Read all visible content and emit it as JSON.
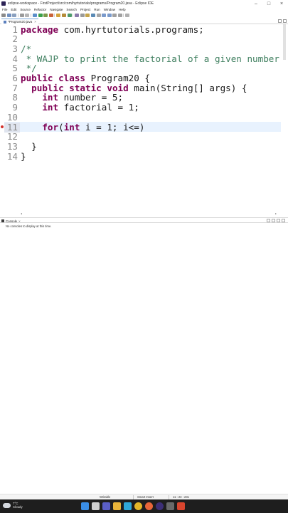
{
  "window": {
    "title": "eclipse-workspace - FirstProject/src/com/hyrtutorials/programs/Program20.java - Eclipse IDE",
    "controls": [
      "minimize-icon",
      "maximize-icon",
      "close-icon"
    ]
  },
  "menubar": {
    "items": [
      "File",
      "Edit",
      "Source",
      "Refactor",
      "Navigate",
      "Search",
      "Project",
      "Run",
      "Window",
      "Help"
    ]
  },
  "editor_tab": {
    "label": "*Program20.java",
    "close": "×"
  },
  "editor": {
    "line_numbers": [
      "1",
      "2",
      "3",
      "4",
      "5",
      "6",
      "7",
      "8",
      "9",
      "10",
      "11",
      "12",
      "13",
      "14"
    ],
    "lines": [
      [
        {
          "t": "package",
          "k": "kw"
        },
        {
          "t": " com.hyrtutorials.programs;",
          "k": ""
        }
      ],
      [],
      [
        {
          "t": "/*",
          "k": "cmt"
        }
      ],
      [
        {
          "t": " * WAJP to print the factorial of a given number",
          "k": "cmt"
        }
      ],
      [
        {
          "t": " */",
          "k": "cmt"
        }
      ],
      [
        {
          "t": "public",
          "k": "kw"
        },
        {
          "t": " ",
          "k": ""
        },
        {
          "t": "class",
          "k": "kw"
        },
        {
          "t": " Program20 {",
          "k": ""
        }
      ],
      [
        {
          "t": "  ",
          "k": ""
        },
        {
          "t": "public",
          "k": "kw"
        },
        {
          "t": " ",
          "k": ""
        },
        {
          "t": "static",
          "k": "kw"
        },
        {
          "t": " ",
          "k": ""
        },
        {
          "t": "void",
          "k": "kw"
        },
        {
          "t": " main(String[] args) {",
          "k": ""
        }
      ],
      [
        {
          "t": "    ",
          "k": ""
        },
        {
          "t": "int",
          "k": "kw"
        },
        {
          "t": " number = 5;",
          "k": ""
        }
      ],
      [
        {
          "t": "    ",
          "k": ""
        },
        {
          "t": "int",
          "k": "kw"
        },
        {
          "t": " factorial = 1;",
          "k": ""
        }
      ],
      [],
      [
        {
          "t": "    ",
          "k": ""
        },
        {
          "t": "for",
          "k": "kw"
        },
        {
          "t": "(",
          "k": ""
        },
        {
          "t": "int",
          "k": "kw"
        },
        {
          "t": " i = 1; i<=)",
          "k": ""
        }
      ],
      [],
      [
        {
          "t": "  }",
          "k": ""
        }
      ],
      [
        {
          "t": "}",
          "k": ""
        }
      ]
    ],
    "current_line": "11",
    "error_line": "11"
  },
  "console": {
    "tab_label": "Console",
    "close": "×",
    "message": "No consoles to display at this time."
  },
  "statusbar": {
    "mode": "Writable",
    "insert": "Smart Insert",
    "position": "11 : 23 : 231"
  },
  "taskbar": {
    "temperature": "7°C",
    "condition": "Cloudy",
    "apps": [
      "windows-start-icon",
      "file-explorer-icon",
      "teams-icon",
      "folder-icon",
      "edge-icon",
      "chrome-icon",
      "firefox-icon",
      "eclipse-icon",
      "media-icon",
      "app-icon"
    ]
  },
  "colors": {
    "keyword": "#7f0055",
    "comment": "#3f7f5f",
    "current_line_bg": "#e8f2fe",
    "taskbar_bg": "#1e1e1e"
  }
}
